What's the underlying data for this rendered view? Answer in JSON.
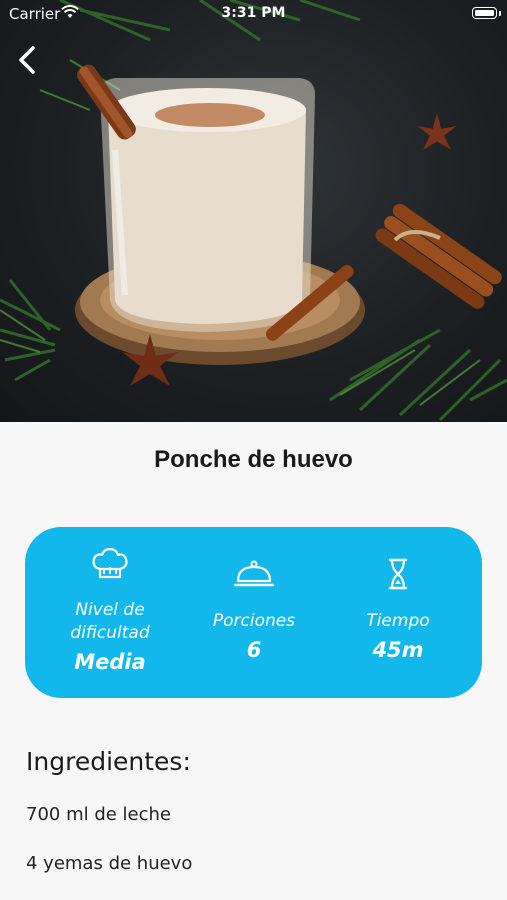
{
  "status_bar": {
    "carrier": "Carrier",
    "time": "3:31 PM"
  },
  "recipe": {
    "title": "Ponche de huevo",
    "stats": {
      "difficulty": {
        "label_line1": "Nivel de",
        "label_line2": "dificultad",
        "value": "Media",
        "icon": "chef-hat-icon"
      },
      "servings": {
        "label": "Porciones",
        "value": "6",
        "icon": "cloche-icon"
      },
      "time": {
        "label": "Tiempo",
        "value": "45m",
        "icon": "hourglass-icon"
      }
    },
    "ingredients_heading": "Ingredientes:",
    "ingredients": [
      "700 ml de leche",
      "4 yemas de huevo"
    ]
  },
  "colors": {
    "accent": "#12b8ec",
    "background": "#f7f7f8",
    "text": "#1a1a1a"
  }
}
